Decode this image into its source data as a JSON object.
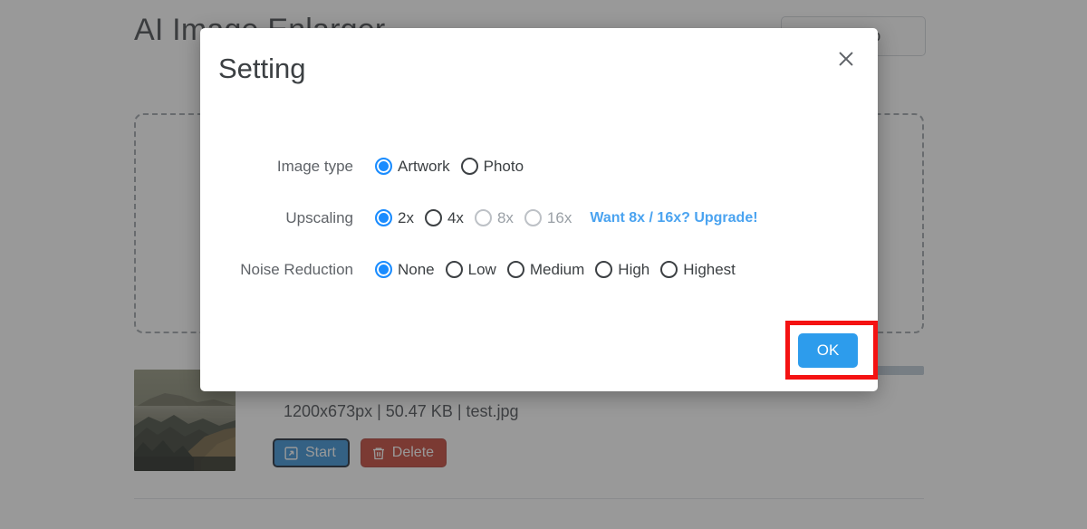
{
  "background": {
    "title": "AI Image Enlarger",
    "signup_label": "Sign Up",
    "dropzone_name": "upload-dropzone",
    "file": {
      "meta": "1200x673px | 50.47 KB | test.jpg",
      "dimensions": "1200x673px",
      "size": "50.47 KB",
      "filename": "test.jpg",
      "start_label": "Start",
      "delete_label": "Delete"
    }
  },
  "modal": {
    "title": "Setting",
    "close_icon": "close-icon",
    "ok_label": "OK",
    "rows": [
      {
        "label": "Image type",
        "name": "image-type",
        "options": [
          {
            "label": "Artwork",
            "checked": true,
            "disabled": false
          },
          {
            "label": "Photo",
            "checked": false,
            "disabled": false
          }
        ]
      },
      {
        "label": "Upscaling",
        "name": "upscaling",
        "options": [
          {
            "label": "2x",
            "checked": true,
            "disabled": false
          },
          {
            "label": "4x",
            "checked": false,
            "disabled": false
          },
          {
            "label": "8x",
            "checked": false,
            "disabled": true
          },
          {
            "label": "16x",
            "checked": false,
            "disabled": true
          }
        ],
        "link": "Want 8x / 16x? Upgrade!"
      },
      {
        "label": "Noise Reduction",
        "name": "noise-reduction",
        "options": [
          {
            "label": "None",
            "checked": true,
            "disabled": false
          },
          {
            "label": "Low",
            "checked": false,
            "disabled": false
          },
          {
            "label": "Medium",
            "checked": false,
            "disabled": false
          },
          {
            "label": "High",
            "checked": false,
            "disabled": false
          },
          {
            "label": "Highest",
            "checked": false,
            "disabled": false
          }
        ]
      }
    ]
  },
  "colors": {
    "accent_blue": "#1a8cff",
    "link_blue": "#4aa3f0",
    "ok_blue": "#2d9cec",
    "annotation_red": "#f41212",
    "delete_red": "#c0392b",
    "start_blue": "#2d8bd4",
    "overlay": "rgba(60,60,60,0.52)"
  }
}
